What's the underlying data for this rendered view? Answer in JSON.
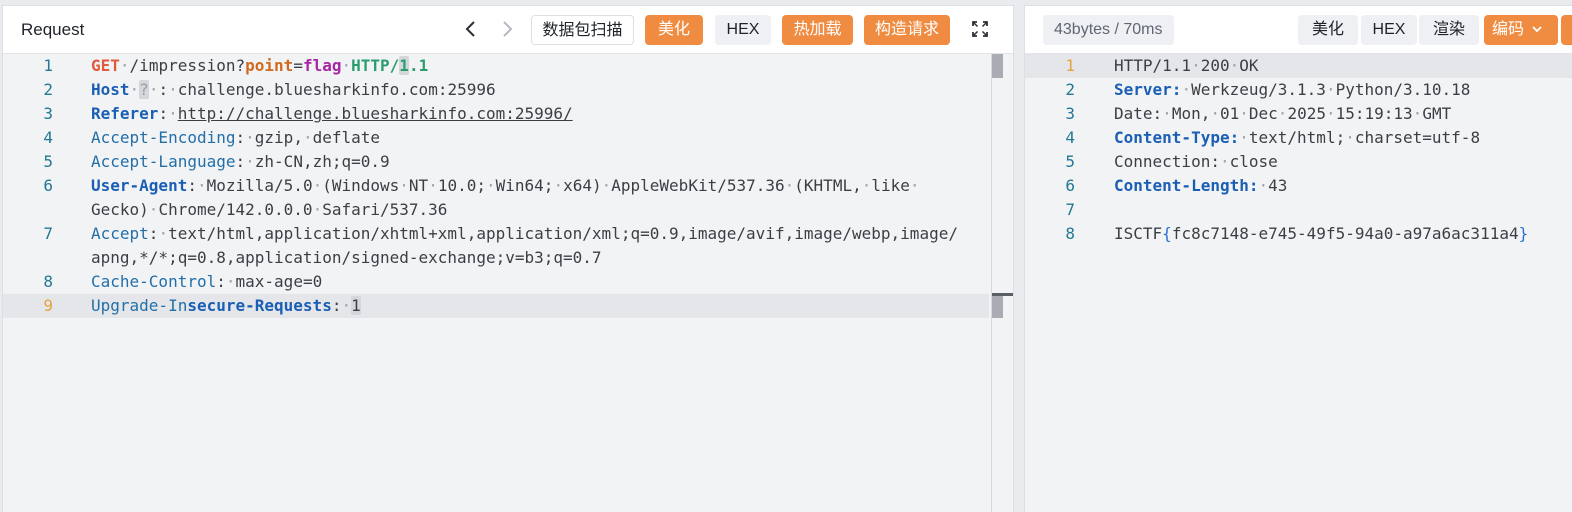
{
  "request": {
    "title": "Request",
    "toolbar": {
      "scan_label": "数据包扫描",
      "beautify_label": "美化",
      "hex_label": "HEX",
      "hot_reload_label": "热加载",
      "build_request_label": "构造请求"
    },
    "lines": [
      {
        "num": "1",
        "segments": [
          {
            "t": "GET",
            "c": "k-method"
          },
          {
            "t": "·",
            "c": "k-dim"
          },
          {
            "t": "/impression?"
          },
          {
            "t": "point",
            "c": "k-param"
          },
          {
            "t": "="
          },
          {
            "t": "flag",
            "c": "k-value"
          },
          {
            "t": "·",
            "c": "k-dim"
          },
          {
            "t": "HTTP/",
            "c": "k-proto"
          },
          {
            "t": "1",
            "c": "k-proto hlbox"
          },
          {
            "t": ".1",
            "c": "k-proto"
          }
        ]
      },
      {
        "num": "2",
        "segments": [
          {
            "t": "Host",
            "c": "k-hdr"
          },
          {
            "t": "·",
            "c": "k-dim"
          },
          {
            "t": "?",
            "c": "k-dim hlbox"
          },
          {
            "t": "·",
            "c": "k-dim"
          },
          {
            "t": ":"
          },
          {
            "t": "·",
            "c": "k-dim"
          },
          {
            "t": "challenge.bluesharkinfo.com:25996"
          }
        ]
      },
      {
        "num": "3",
        "segments": [
          {
            "t": "Referer",
            "c": "k-hdr"
          },
          {
            "t": ":"
          },
          {
            "t": "·",
            "c": "k-dim"
          },
          {
            "t": "http://challenge.bluesharkinfo.com:25996/",
            "c": "k-link"
          }
        ]
      },
      {
        "num": "4",
        "segments": [
          {
            "t": "Accept-Encoding",
            "c": "k-hdr2"
          },
          {
            "t": ":"
          },
          {
            "t": "·",
            "c": "k-dim"
          },
          {
            "t": "gzip,"
          },
          {
            "t": "·",
            "c": "k-dim"
          },
          {
            "t": "deflate"
          }
        ]
      },
      {
        "num": "5",
        "segments": [
          {
            "t": "Accept-Language",
            "c": "k-hdr2"
          },
          {
            "t": ":"
          },
          {
            "t": "·",
            "c": "k-dim"
          },
          {
            "t": "zh-CN,zh;q=0.9"
          }
        ]
      },
      {
        "num": "6",
        "segments": [
          {
            "t": "User-Agent",
            "c": "k-hdr"
          },
          {
            "t": ":"
          },
          {
            "t": "·",
            "c": "k-dim"
          },
          {
            "t": "Mozilla/5.0"
          },
          {
            "t": "·",
            "c": "k-dim"
          },
          {
            "t": "(Windows"
          },
          {
            "t": "·",
            "c": "k-dim"
          },
          {
            "t": "NT"
          },
          {
            "t": "·",
            "c": "k-dim"
          },
          {
            "t": "10.0;"
          },
          {
            "t": "·",
            "c": "k-dim"
          },
          {
            "t": "Win64;"
          },
          {
            "t": "·",
            "c": "k-dim"
          },
          {
            "t": "x64)"
          },
          {
            "t": "·",
            "c": "k-dim"
          },
          {
            "t": "AppleWebKit/537.36"
          },
          {
            "t": "·",
            "c": "k-dim"
          },
          {
            "t": "(KHTML,"
          },
          {
            "t": "·",
            "c": "k-dim"
          },
          {
            "t": "like"
          },
          {
            "t": "·",
            "c": "k-dim"
          }
        ]
      },
      {
        "num": "",
        "segments": [
          {
            "t": "Gecko)"
          },
          {
            "t": "·",
            "c": "k-dim"
          },
          {
            "t": "Chrome/142.0.0.0"
          },
          {
            "t": "·",
            "c": "k-dim"
          },
          {
            "t": "Safari/537.36"
          }
        ]
      },
      {
        "num": "7",
        "segments": [
          {
            "t": "Accept",
            "c": "k-hdr2"
          },
          {
            "t": ":"
          },
          {
            "t": "·",
            "c": "k-dim"
          },
          {
            "t": "text/html,application/xhtml+xml,application/xml;q=0.9,image/avif,image/webp,image/"
          }
        ]
      },
      {
        "num": "",
        "segments": [
          {
            "t": "apng,*/*;q=0.8,application/signed-exchange;v=b3;q=0.7"
          }
        ]
      },
      {
        "num": "8",
        "segments": [
          {
            "t": "Cache-Control",
            "c": "k-hdr2"
          },
          {
            "t": ":"
          },
          {
            "t": "·",
            "c": "k-dim"
          },
          {
            "t": "max-age=0"
          }
        ]
      },
      {
        "num": "9",
        "active": true,
        "segments": [
          {
            "t": "Upgrade-In",
            "c": "k-hdr2"
          },
          {
            "t": "secure-Requests",
            "c": "k-hdr"
          },
          {
            "t": ":"
          },
          {
            "t": "·",
            "c": "k-dim"
          },
          {
            "t": "1",
            "c": "hlbox"
          }
        ]
      }
    ]
  },
  "response": {
    "stats": "43bytes / 70ms",
    "toolbar": {
      "beautify_label": "美化",
      "hex_label": "HEX",
      "render_label": "渲染",
      "encode_label": "编码"
    },
    "lines": [
      {
        "num": "1",
        "active": true,
        "segments": [
          {
            "t": "HTTP/1.1"
          },
          {
            "t": "·",
            "c": "k-dim"
          },
          {
            "t": "200"
          },
          {
            "t": "·",
            "c": "k-dim"
          },
          {
            "t": "OK"
          }
        ]
      },
      {
        "num": "2",
        "segments": [
          {
            "t": "Server:",
            "c": "k-hdr"
          },
          {
            "t": "·",
            "c": "k-dim"
          },
          {
            "t": "Werkzeug/3.1.3"
          },
          {
            "t": "·",
            "c": "k-dim"
          },
          {
            "t": "Python/3.10.18"
          }
        ]
      },
      {
        "num": "3",
        "segments": [
          {
            "t": "Date:"
          },
          {
            "t": "·",
            "c": "k-dim"
          },
          {
            "t": "Mon,"
          },
          {
            "t": "·",
            "c": "k-dim"
          },
          {
            "t": "01"
          },
          {
            "t": "·",
            "c": "k-dim"
          },
          {
            "t": "Dec"
          },
          {
            "t": "·",
            "c": "k-dim"
          },
          {
            "t": "2025"
          },
          {
            "t": "·",
            "c": "k-dim"
          },
          {
            "t": "15:19:13"
          },
          {
            "t": "·",
            "c": "k-dim"
          },
          {
            "t": "GMT"
          }
        ]
      },
      {
        "num": "4",
        "segments": [
          {
            "t": "Content-Type:",
            "c": "k-hdr"
          },
          {
            "t": "·",
            "c": "k-dim"
          },
          {
            "t": "text/html;"
          },
          {
            "t": "·",
            "c": "k-dim"
          },
          {
            "t": "charset=utf-8"
          }
        ]
      },
      {
        "num": "5",
        "segments": [
          {
            "t": "Connection:"
          },
          {
            "t": "·",
            "c": "k-dim"
          },
          {
            "t": "close"
          }
        ]
      },
      {
        "num": "6",
        "segments": [
          {
            "t": "Content-Length:",
            "c": "k-hdr"
          },
          {
            "t": "·",
            "c": "k-dim"
          },
          {
            "t": "43"
          }
        ]
      },
      {
        "num": "7",
        "segments": []
      },
      {
        "num": "8",
        "segments": [
          {
            "t": "ISCTF"
          },
          {
            "t": "{",
            "c": "brace"
          },
          {
            "t": "fc8c7148-e745-49f5-94a0-a97a6ac311a4"
          },
          {
            "t": "}",
            "c": "brace"
          }
        ]
      }
    ]
  },
  "colors": {
    "accent_orange": "#f08c42",
    "line_number": "#237893",
    "active_line_number": "#e6a23c",
    "header_key": "#1a5fb4"
  },
  "icons": [
    "chevron-left-icon",
    "chevron-right-icon",
    "fullscreen-icon",
    "chevron-down-icon"
  ]
}
